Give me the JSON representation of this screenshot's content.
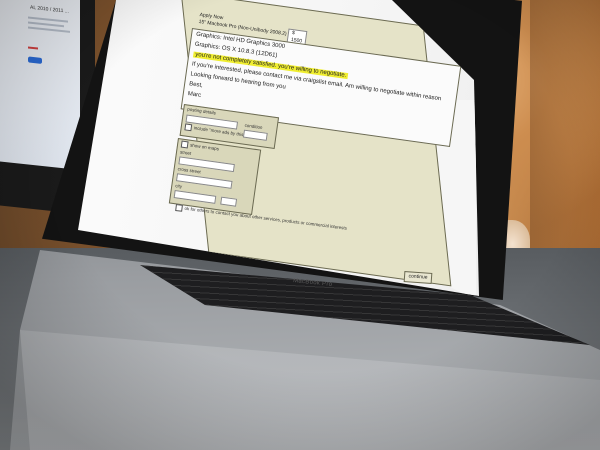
{
  "photo": {
    "description_colors": {
      "wall": "#c4884d",
      "form_panel": "#e5e3c8",
      "highlight": "#f0ee30",
      "desk": "#6c7074"
    }
  },
  "background_monitor": {
    "title": "AL 2010 / 2011 ..."
  },
  "form": {
    "header_line1": "Apply Now",
    "header_line2": "15\" Macbook Pro (Non-Unibody 2008.2)",
    "header_pill": "$ 1500",
    "message_line1": "Graphics: Intel HD Graphics 3000",
    "message_line2": "Graphics: OS X 10.8.3 (12D61)",
    "message_highlight": "you're not completely satisfied. you're willing to negotiate.",
    "message_line3": "If you're interested, please contact me via craigslist email. Am willing to negotiate within reason",
    "message_line4": "Looking forward to hearing from you",
    "message_line5": "Best,",
    "message_line6": "Marc",
    "posting_details_label": "posting details",
    "include_checkbox_label": "include \"more ads by this user\" link",
    "condition_label": "condition",
    "show_on_maps_label": "show on maps",
    "street_label": "street",
    "cross_street_label": "cross street",
    "city_label": "city",
    "consent_label": "ok for others to contact you about other services, products or commercial interests",
    "continue_label": "continue"
  },
  "laptop": {
    "brand": "MacBook Pro"
  }
}
